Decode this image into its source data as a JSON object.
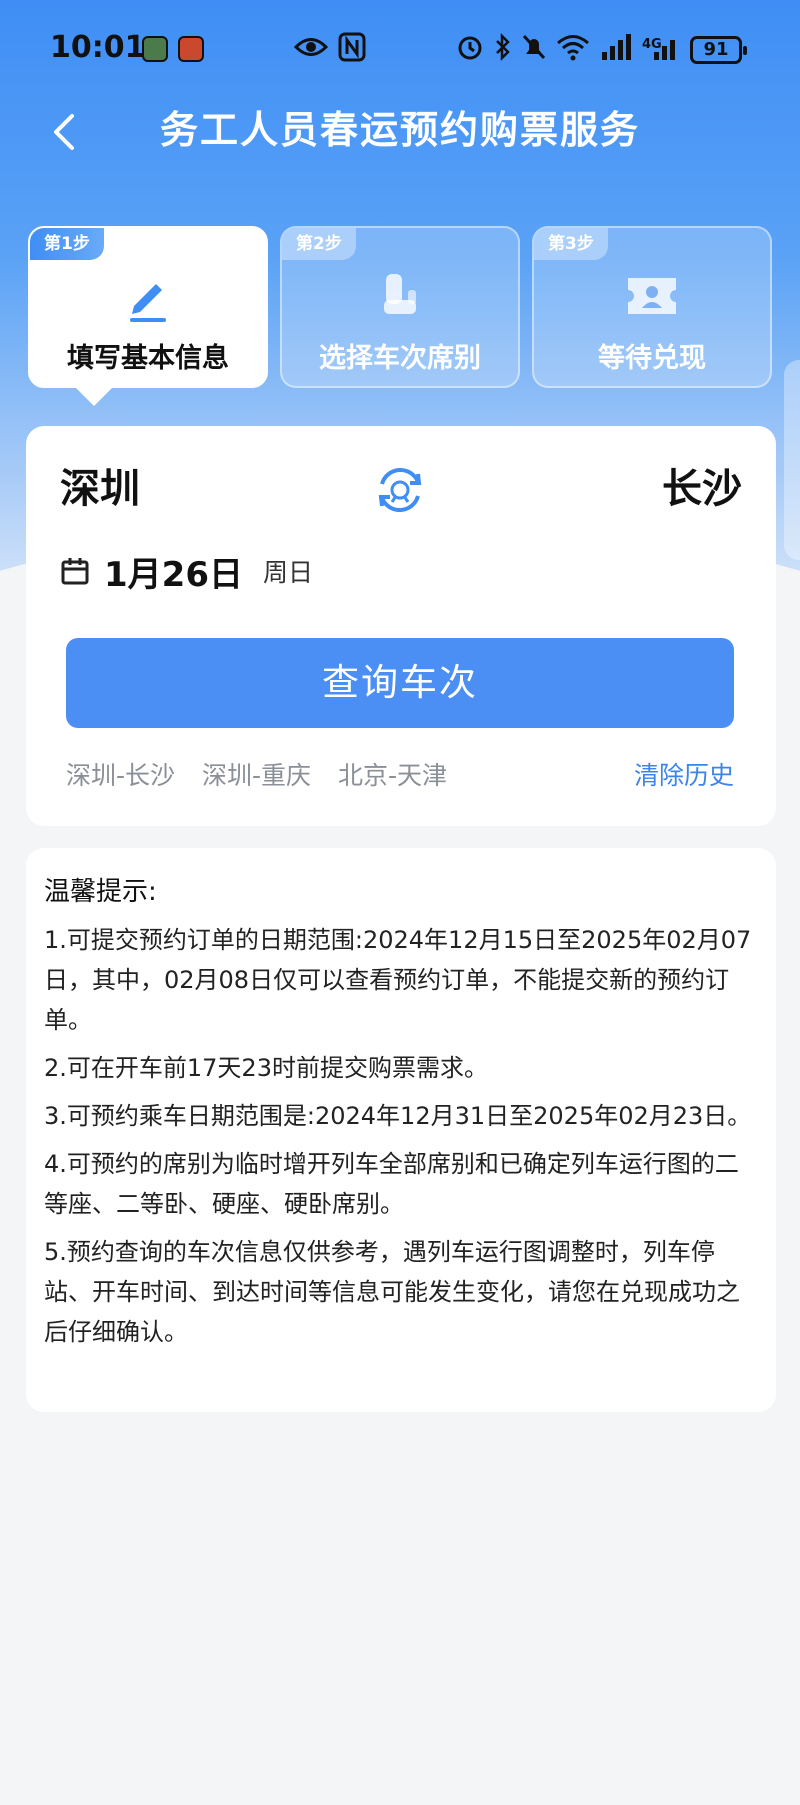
{
  "status_bar": {
    "time": "10:01",
    "battery": "91",
    "network": "4G",
    "icons": [
      "eye-icon",
      "nfc-icon",
      "alarm-icon",
      "bluetooth-icon",
      "mute-icon",
      "wifi-icon",
      "signal-icon"
    ]
  },
  "nav": {
    "title": "务工人员春运预约购票服务"
  },
  "steps": [
    {
      "badge": "第1步",
      "label": "填写基本信息",
      "icon": "pencil-icon",
      "active": true
    },
    {
      "badge": "第2步",
      "label": "选择车次席别",
      "icon": "seat-icon",
      "active": false
    },
    {
      "badge": "第3步",
      "label": "等待兑现",
      "icon": "ticket-icon",
      "active": false
    }
  ],
  "query": {
    "from_city": "深圳",
    "to_city": "长沙",
    "date": "1月26日",
    "weekday": "周日",
    "search_label": "查询车次",
    "history": [
      "深圳-长沙",
      "深圳-重庆",
      "北京-天津"
    ],
    "clear_history_label": "清除历史"
  },
  "tips": {
    "title": "温馨提示:",
    "items": [
      "1.可提交预约订单的日期范围:2024年12月15日至2025年02月07日，其中，02月08日仅可以查看预约订单，不能提交新的预约订单。",
      "2.可在开车前17天23时前提交购票需求。",
      "3.可预约乘车日期范围是:2024年12月31日至2025年02月23日。",
      "4.可预约的席别为临时增开列车全部席别和已确定列车运行图的二等座、二等卧、硬座、硬卧席别。",
      "5.预约查询的车次信息仅供参考，遇列车运行图调整时，列车停站、开车时间、到达时间等信息可能发生变化，请您在兑现成功之后仔细确认。"
    ]
  },
  "colors": {
    "primary": "#4b8ff5",
    "link": "#3b84e8",
    "hero_top": "#3f8ef5",
    "background": "#f4f5f7"
  }
}
